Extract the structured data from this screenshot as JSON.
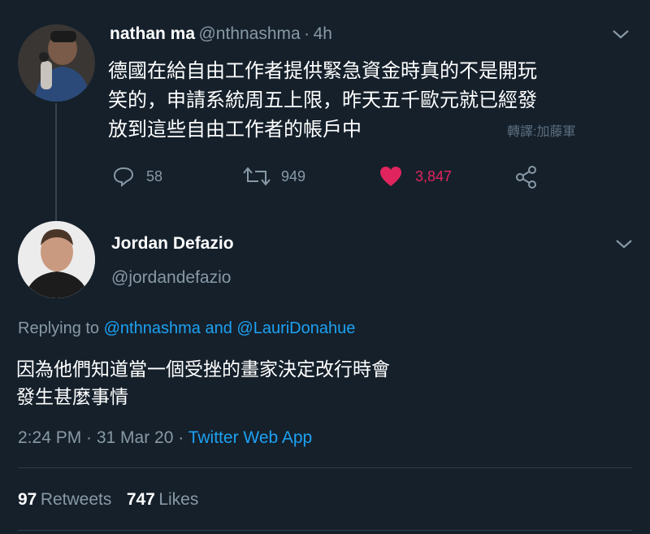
{
  "tweet1": {
    "author": "nathan ma",
    "handle": "@nthnashma",
    "separator": "·",
    "time": "4h",
    "text_lines": [
      "德國在給自由工作者提供緊急資金時真的不是開玩",
      "笑的，申請系統周五上限，昨天五千歐元就已經發",
      "放到這些自由工作者的帳戶中"
    ],
    "translation_credit": "轉譯:加藤軍",
    "replies": "58",
    "retweets": "949",
    "likes": "3,847"
  },
  "tweet2": {
    "author": "Jordan Defazio",
    "handle": "@jordandefazio",
    "replying_prefix": "Replying to",
    "replying_user1": "@nthnashma",
    "replying_and": "and",
    "replying_user2": "@LauriDonahue",
    "text_lines": [
      "因為他們知道當一個受挫的畫家決定改行時會",
      "發生甚麼事情"
    ],
    "timestamp": "2:24 PM · 31 Mar 20 ·",
    "source": "Twitter Web App",
    "retweets_count": "97",
    "retweets_label": "Retweets",
    "likes_count": "747",
    "likes_label": "Likes"
  },
  "colors": {
    "background": "#15202b",
    "link": "#1da1f2",
    "like": "#e0245e",
    "secondary_text": "#8899a6"
  }
}
